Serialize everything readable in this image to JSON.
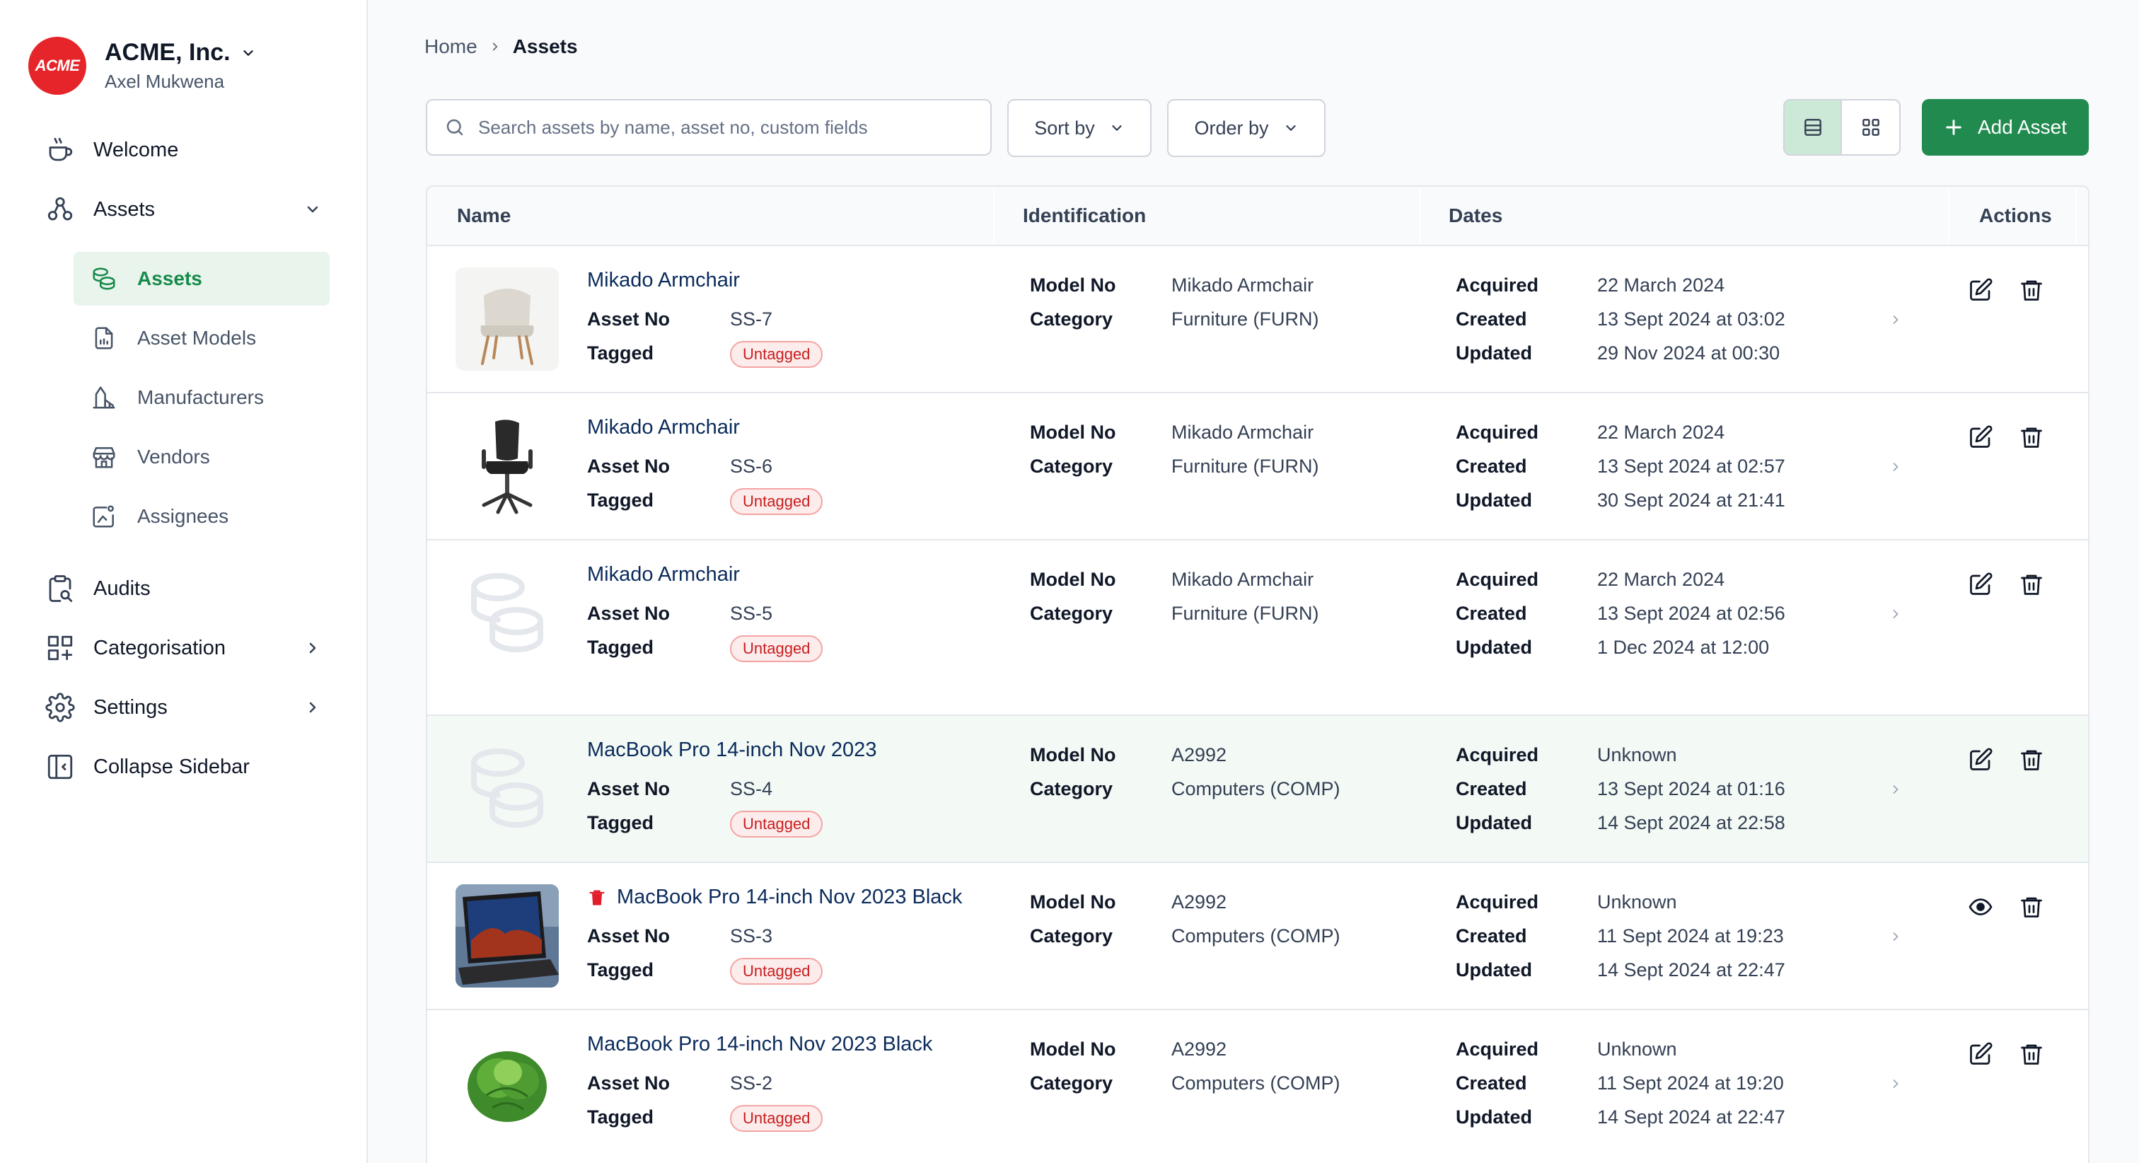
{
  "org": {
    "logo_text": "ACME",
    "name": "ACME, Inc.",
    "user": "Axel Mukwena"
  },
  "nav": {
    "welcome": "Welcome",
    "assets": "Assets",
    "sub": {
      "assets": "Assets",
      "asset_models": "Asset Models",
      "manufacturers": "Manufacturers",
      "vendors": "Vendors",
      "assignees": "Assignees"
    },
    "audits": "Audits",
    "categorisation": "Categorisation",
    "settings": "Settings",
    "collapse": "Collapse Sidebar"
  },
  "breadcrumb": {
    "home": "Home",
    "current": "Assets"
  },
  "toolbar": {
    "search_placeholder": "Search assets by name, asset no, custom fields",
    "sort_by": "Sort by",
    "order_by": "Order by",
    "add_asset": "Add Asset"
  },
  "table": {
    "headers": {
      "name": "Name",
      "identification": "Identification",
      "dates": "Dates",
      "actions": "Actions"
    },
    "labels": {
      "asset_no": "Asset No",
      "tagged": "Tagged",
      "model_no": "Model No",
      "category": "Category",
      "acquired": "Acquired",
      "created": "Created",
      "updated": "Updated"
    },
    "rows": [
      {
        "name": "Mikado Armchair",
        "asset_no": "SS-7",
        "tagged": "Untagged",
        "model_no": "Mikado Armchair",
        "category": "Furniture (FURN)",
        "acquired": "22 March 2024",
        "created": "13 Sept 2024 at 03:02",
        "updated": "29 Nov 2024 at 00:30",
        "thumb": "armchair-image",
        "action": "edit"
      },
      {
        "name": "Mikado Armchair",
        "asset_no": "SS-6",
        "tagged": "Untagged",
        "model_no": "Mikado Armchair",
        "category": "Furniture (FURN)",
        "acquired": "22 March 2024",
        "created": "13 Sept 2024 at 02:57",
        "updated": "30 Sept 2024 at 21:41",
        "thumb": "office-chair-image",
        "action": "edit"
      },
      {
        "name": "Mikado Armchair",
        "asset_no": "SS-5",
        "tagged": "Untagged",
        "model_no": "Mikado Armchair",
        "category": "Furniture (FURN)",
        "acquired": "22 March 2024",
        "created": "13 Sept 2024 at 02:56",
        "updated": "1 Dec 2024 at 12:00",
        "thumb": "placeholder-icon",
        "action": "edit"
      },
      {
        "name": "MacBook Pro 14-inch Nov 2023",
        "asset_no": "SS-4",
        "tagged": "Untagged",
        "model_no": "A2992",
        "category": "Computers (COMP)",
        "acquired": "Unknown",
        "created": "13 Sept 2024 at 01:16",
        "updated": "14 Sept 2024 at 22:58",
        "thumb": "placeholder-icon",
        "action": "edit"
      },
      {
        "name": "MacBook Pro 14-inch Nov 2023 Black",
        "asset_no": "SS-3",
        "tagged": "Untagged",
        "model_no": "A2992",
        "category": "Computers (COMP)",
        "acquired": "Unknown",
        "created": "11 Sept 2024 at 19:23",
        "updated": "14 Sept 2024 at 22:47",
        "thumb": "laptop-image",
        "action": "view"
      },
      {
        "name": "MacBook Pro 14-inch Nov 2023 Black",
        "asset_no": "SS-2",
        "tagged": "Untagged",
        "model_no": "A2992",
        "category": "Computers (COMP)",
        "acquired": "Unknown",
        "created": "11 Sept 2024 at 19:20",
        "updated": "14 Sept 2024 at 22:47",
        "thumb": "lettuce-image",
        "action": "edit"
      }
    ]
  },
  "colors": {
    "accent": "#218a4f",
    "active_bg": "#e8f4ec",
    "badge_red": "#c81e1e",
    "logo_red": "#e5252a"
  }
}
